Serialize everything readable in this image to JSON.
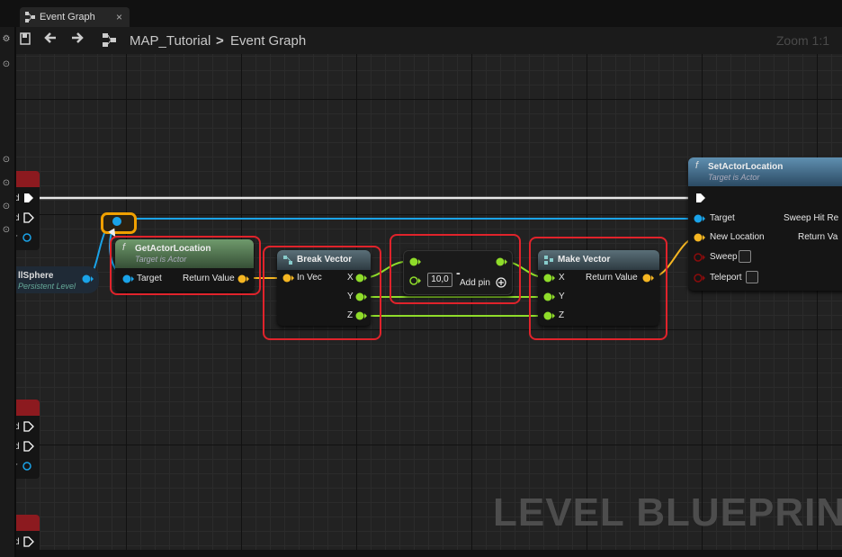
{
  "tab": {
    "title": "Event Graph",
    "close": "×"
  },
  "toolbar": {
    "breadcrumb_root": "MAP_Tutorial",
    "separator": ">",
    "breadcrumb_current": "Event Graph",
    "zoom": "Zoom 1:1"
  },
  "watermark": "LEVEL BLUEPRINT",
  "left_nodes": {
    "top_labels": [
      "d",
      "d",
      "r"
    ],
    "mid_labels": [
      "d",
      "d",
      "r"
    ],
    "bottom_labels": [
      "d"
    ],
    "sphere_title": "llSphere",
    "sphere_sub": "Persistent Level"
  },
  "nodes": {
    "get_actor_location": {
      "icon": "f",
      "title": "GetActorLocation",
      "subtitle": "Target is Actor",
      "pin_target": "Target",
      "pin_return": "Return Value"
    },
    "break_vector": {
      "title": "Break Vector",
      "pin_in": "In Vec",
      "pin_x": "X",
      "pin_y": "Y",
      "pin_z": "Z"
    },
    "add": {
      "operator": "-",
      "value": "10,0",
      "add_pin": "Add pin"
    },
    "make_vector": {
      "title": "Make Vector",
      "pin_x": "X",
      "pin_y": "Y",
      "pin_z": "Z",
      "pin_return": "Return Value"
    },
    "set_actor_location": {
      "icon": "f",
      "title": "SetActorLocation",
      "subtitle": "Target is Actor",
      "pin_target": "Target",
      "pin_new_location": "New Location",
      "pin_sweep": "Sweep",
      "pin_teleport": "Teleport",
      "pin_sweep_hit": "Sweep Hit Re",
      "pin_return": "Return Va"
    }
  },
  "colors": {
    "exec": "#ffffff",
    "object": "#1aa3e8",
    "vector": "#f5b622",
    "float": "#8fdc2a",
    "bool": "#8a0c0c",
    "highlight": "#e0232b",
    "reroute": "#f0a000"
  }
}
